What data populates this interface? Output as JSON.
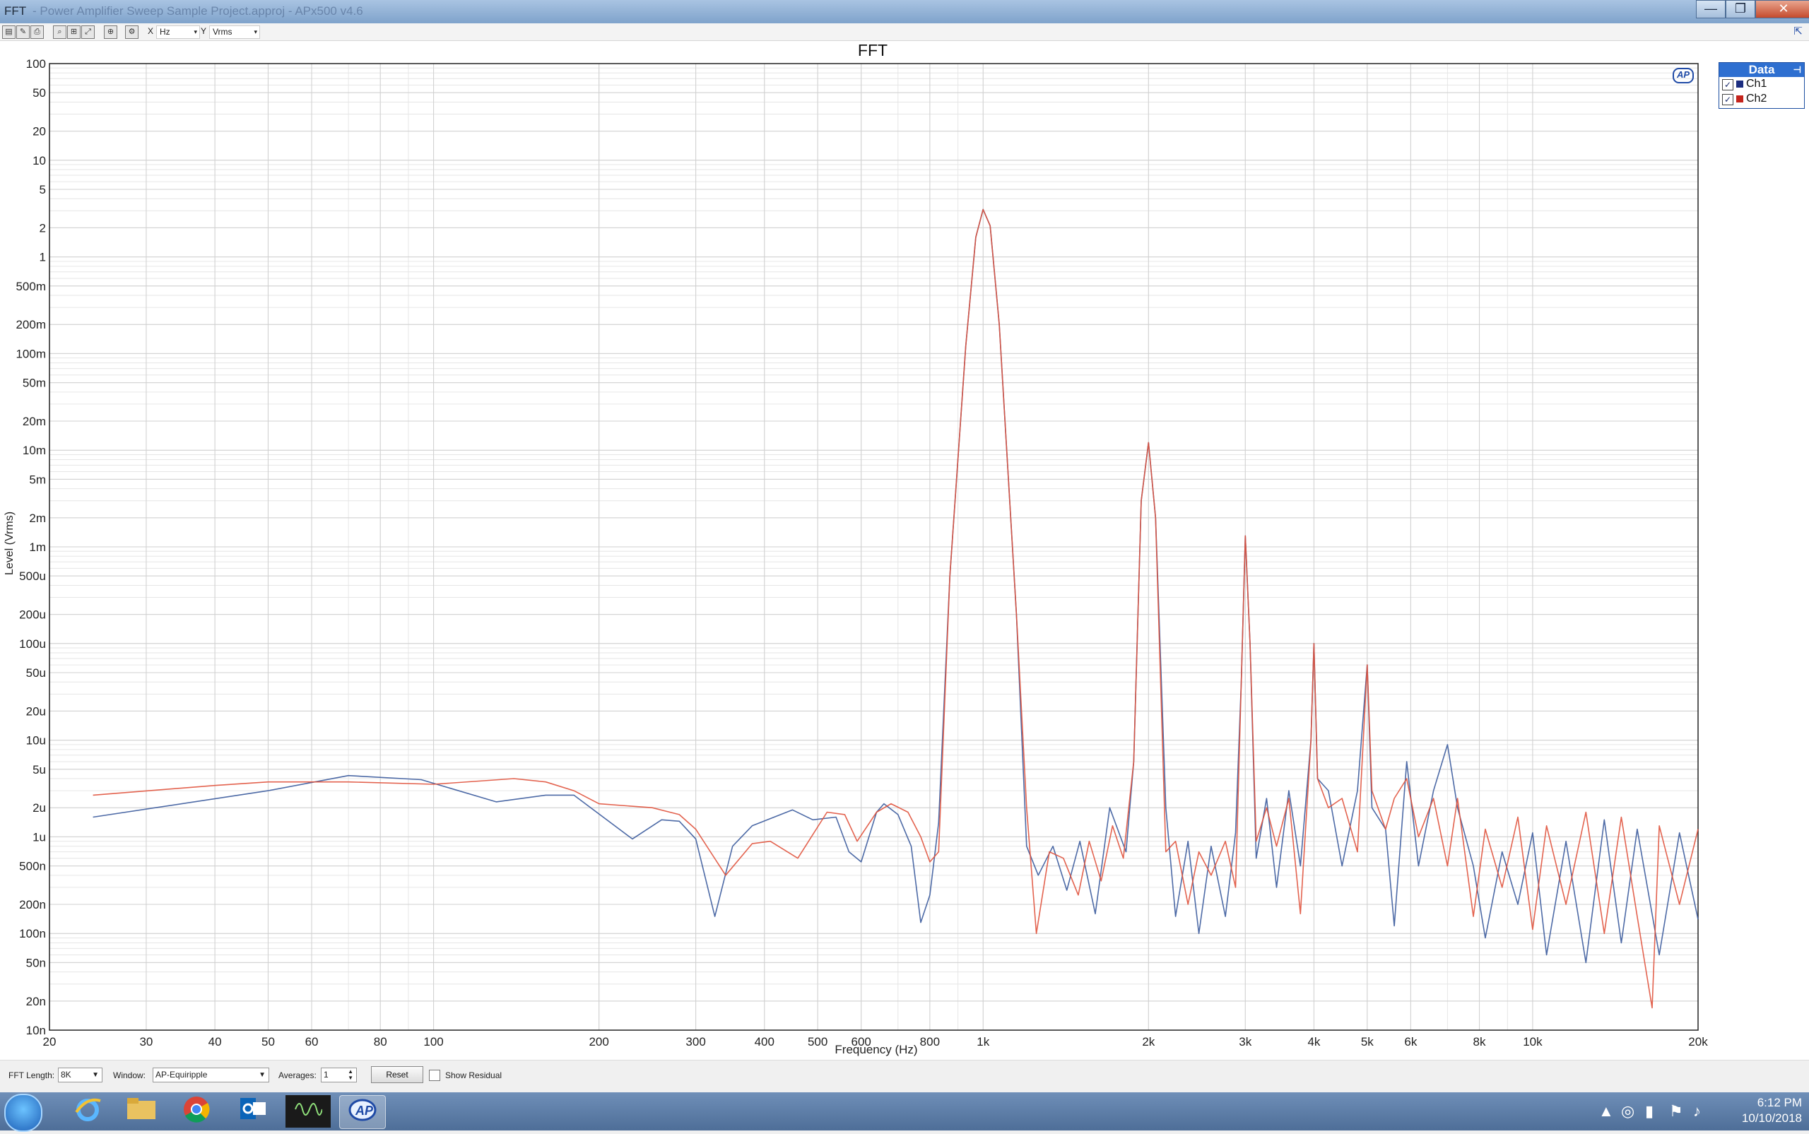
{
  "window": {
    "title_app": "FFT",
    "title_rest": "- Power Amplifier Sweep Sample Project.approj - APx500 v4.6",
    "minimize": "—",
    "maximize": "❐",
    "close": "✕"
  },
  "toolbar": {
    "x_label": "X",
    "x_unit": "Hz",
    "y_label": "Y",
    "y_unit": "Vrms",
    "arrow": "▾"
  },
  "legend": {
    "title": "Data",
    "pin": "⊣",
    "items": [
      {
        "name": "Ch1",
        "color": "#1c2e80",
        "checked": "✓"
      },
      {
        "name": "Ch2",
        "color": "#c4241c",
        "checked": "✓"
      }
    ]
  },
  "logo": "AP",
  "bottom": {
    "fft_length_label": "FFT Length:",
    "fft_length_value": "8K",
    "window_label": "Window:",
    "window_value": "AP-Equiripple",
    "averages_label": "Averages:",
    "averages_value": "1",
    "reset_label": "Reset",
    "show_residual_label": "Show Residual"
  },
  "taskbar": {
    "time": "6:12 PM",
    "date": "10/10/2018",
    "apps": [
      "windows-start",
      "internet-explorer",
      "file-explorer",
      "chrome",
      "outlook",
      "scope-app",
      "ap-app"
    ]
  },
  "chart_data": {
    "type": "line",
    "title": "FFT",
    "xlabel": "Frequency (Hz)",
    "ylabel": "Level (Vrms)",
    "x_scale": "log",
    "y_scale": "log",
    "xlim": [
      20,
      20000
    ],
    "ylim": [
      1e-08,
      100
    ],
    "grid": true,
    "legend_position": "right, outside plot",
    "x_ticks": [
      {
        "v": 20,
        "l": "20"
      },
      {
        "v": 30,
        "l": "30"
      },
      {
        "v": 40,
        "l": "40"
      },
      {
        "v": 50,
        "l": "50"
      },
      {
        "v": 60,
        "l": "60"
      },
      {
        "v": 80,
        "l": "80"
      },
      {
        "v": 100,
        "l": "100"
      },
      {
        "v": 200,
        "l": "200"
      },
      {
        "v": 300,
        "l": "300"
      },
      {
        "v": 400,
        "l": "400"
      },
      {
        "v": 500,
        "l": "500"
      },
      {
        "v": 600,
        "l": "600"
      },
      {
        "v": 800,
        "l": "800"
      },
      {
        "v": 1000,
        "l": "1k"
      },
      {
        "v": 2000,
        "l": "2k"
      },
      {
        "v": 3000,
        "l": "3k"
      },
      {
        "v": 4000,
        "l": "4k"
      },
      {
        "v": 5000,
        "l": "5k"
      },
      {
        "v": 6000,
        "l": "6k"
      },
      {
        "v": 8000,
        "l": "8k"
      },
      {
        "v": 10000,
        "l": "10k"
      },
      {
        "v": 20000,
        "l": "20k"
      }
    ],
    "y_ticks": [
      {
        "v": 100,
        "l": "100"
      },
      {
        "v": 50,
        "l": "50"
      },
      {
        "v": 20,
        "l": "20"
      },
      {
        "v": 10,
        "l": "10"
      },
      {
        "v": 5,
        "l": "5"
      },
      {
        "v": 2,
        "l": "2"
      },
      {
        "v": 1,
        "l": "1"
      },
      {
        "v": 0.5,
        "l": "500m"
      },
      {
        "v": 0.2,
        "l": "200m"
      },
      {
        "v": 0.1,
        "l": "100m"
      },
      {
        "v": 0.05,
        "l": "50m"
      },
      {
        "v": 0.02,
        "l": "20m"
      },
      {
        "v": 0.01,
        "l": "10m"
      },
      {
        "v": 0.005,
        "l": "5m"
      },
      {
        "v": 0.002,
        "l": "2m"
      },
      {
        "v": 0.001,
        "l": "1m"
      },
      {
        "v": 0.0005,
        "l": "500u"
      },
      {
        "v": 0.0002,
        "l": "200u"
      },
      {
        "v": 0.0001,
        "l": "100u"
      },
      {
        "v": 5e-05,
        "l": "50u"
      },
      {
        "v": 2e-05,
        "l": "20u"
      },
      {
        "v": 1e-05,
        "l": "10u"
      },
      {
        "v": 5e-06,
        "l": "5u"
      },
      {
        "v": 2e-06,
        "l": "2u"
      },
      {
        "v": 1e-06,
        "l": "1u"
      },
      {
        "v": 5e-07,
        "l": "500n"
      },
      {
        "v": 2e-07,
        "l": "200n"
      },
      {
        "v": 1e-07,
        "l": "100n"
      },
      {
        "v": 5e-08,
        "l": "50n"
      },
      {
        "v": 2e-08,
        "l": "20n"
      },
      {
        "v": 1e-08,
        "l": "10n"
      }
    ],
    "series": [
      {
        "name": "Ch1",
        "color": "#3a5a9c",
        "points": [
          [
            24,
            1.6e-06
          ],
          [
            50,
            3e-06
          ],
          [
            70,
            4.3e-06
          ],
          [
            95,
            3.9e-06
          ],
          [
            130,
            2.3e-06
          ],
          [
            160,
            2.7e-06
          ],
          [
            180,
            2.7e-06
          ],
          [
            230,
            9.5e-07
          ],
          [
            260,
            1.5e-06
          ],
          [
            280,
            1.45e-06
          ],
          [
            300,
            9.5e-07
          ],
          [
            325,
            1.5e-07
          ],
          [
            350,
            8e-07
          ],
          [
            380,
            1.3e-06
          ],
          [
            450,
            1.9e-06
          ],
          [
            490,
            1.5e-06
          ],
          [
            540,
            1.6e-06
          ],
          [
            570,
            7e-07
          ],
          [
            600,
            5.5e-07
          ],
          [
            640,
            1.8e-06
          ],
          [
            660,
            2.2e-06
          ],
          [
            700,
            1.7e-06
          ],
          [
            740,
            8e-07
          ],
          [
            770,
            1.3e-07
          ],
          [
            800,
            2.5e-07
          ],
          [
            830,
            1.4e-06
          ],
          [
            870,
            0.0005
          ],
          [
            930,
            0.12
          ],
          [
            970,
            1.6
          ],
          [
            1000,
            3.1
          ],
          [
            1030,
            2.1
          ],
          [
            1070,
            0.2
          ],
          [
            1150,
            0.0002
          ],
          [
            1200,
            8e-07
          ],
          [
            1260,
            4e-07
          ],
          [
            1340,
            8e-07
          ],
          [
            1420,
            2.8e-07
          ],
          [
            1500,
            9e-07
          ],
          [
            1600,
            1.6e-07
          ],
          [
            1700,
            2e-06
          ],
          [
            1820,
            7e-07
          ],
          [
            1880,
            6e-06
          ],
          [
            1940,
            0.003
          ],
          [
            2000,
            0.012
          ],
          [
            2060,
            0.002
          ],
          [
            2150,
            2e-06
          ],
          [
            2240,
            1.5e-07
          ],
          [
            2360,
            9e-07
          ],
          [
            2470,
            1e-07
          ],
          [
            2600,
            8e-07
          ],
          [
            2760,
            1.5e-07
          ],
          [
            2880,
            1.1e-06
          ],
          [
            2950,
            4e-05
          ],
          [
            3000,
            0.0013
          ],
          [
            3060,
            0.0001
          ],
          [
            3140,
            6e-07
          ],
          [
            3280,
            2.5e-06
          ],
          [
            3420,
            3e-07
          ],
          [
            3600,
            3e-06
          ],
          [
            3780,
            5e-07
          ],
          [
            3950,
            1e-05
          ],
          [
            4000,
            0.0001
          ],
          [
            4060,
            4e-06
          ],
          [
            4250,
            3e-06
          ],
          [
            4500,
            5e-07
          ],
          [
            4800,
            3e-06
          ],
          [
            5000,
            6e-05
          ],
          [
            5100,
            2e-06
          ],
          [
            5400,
            1.2e-06
          ],
          [
            5600,
            1.2e-07
          ],
          [
            5900,
            6e-06
          ],
          [
            6200,
            5e-07
          ],
          [
            6600,
            3e-06
          ],
          [
            7000,
            9e-06
          ],
          [
            7300,
            2e-06
          ],
          [
            7800,
            5e-07
          ],
          [
            8200,
            9e-08
          ],
          [
            8800,
            7e-07
          ],
          [
            9400,
            2e-07
          ],
          [
            10000,
            1.1e-06
          ],
          [
            10600,
            6e-08
          ],
          [
            11500,
            9e-07
          ],
          [
            12500,
            5e-08
          ],
          [
            13500,
            1.5e-06
          ],
          [
            14500,
            8e-08
          ],
          [
            15500,
            1.2e-06
          ],
          [
            17000,
            6e-08
          ],
          [
            18500,
            1.1e-06
          ],
          [
            20000,
            1.4e-07
          ]
        ]
      },
      {
        "name": "Ch2",
        "color": "#e0523c",
        "points": [
          [
            24,
            2.7e-06
          ],
          [
            40,
            3.4e-06
          ],
          [
            50,
            3.7e-06
          ],
          [
            70,
            3.7e-06
          ],
          [
            100,
            3.5e-06
          ],
          [
            140,
            4e-06
          ],
          [
            160,
            3.7e-06
          ],
          [
            180,
            3e-06
          ],
          [
            200,
            2.2e-06
          ],
          [
            250,
            2e-06
          ],
          [
            280,
            1.7e-06
          ],
          [
            300,
            1.2e-06
          ],
          [
            340,
            4e-07
          ],
          [
            380,
            8.5e-07
          ],
          [
            410,
            9e-07
          ],
          [
            460,
            6e-07
          ],
          [
            520,
            1.8e-06
          ],
          [
            560,
            1.7e-06
          ],
          [
            590,
            9e-07
          ],
          [
            640,
            1.8e-06
          ],
          [
            680,
            2.2e-06
          ],
          [
            730,
            1.8e-06
          ],
          [
            770,
            1e-06
          ],
          [
            800,
            5.5e-07
          ],
          [
            830,
            7e-07
          ],
          [
            870,
            0.0005
          ],
          [
            930,
            0.12
          ],
          [
            970,
            1.6
          ],
          [
            1000,
            3.1
          ],
          [
            1030,
            2.1
          ],
          [
            1070,
            0.2
          ],
          [
            1150,
            0.0002
          ],
          [
            1200,
            2e-06
          ],
          [
            1250,
            1e-07
          ],
          [
            1320,
            7e-07
          ],
          [
            1400,
            6e-07
          ],
          [
            1490,
            2.5e-07
          ],
          [
            1560,
            9e-07
          ],
          [
            1640,
            3.5e-07
          ],
          [
            1720,
            1.3e-06
          ],
          [
            1800,
            6e-07
          ],
          [
            1880,
            6e-06
          ],
          [
            1940,
            0.003
          ],
          [
            2000,
            0.012
          ],
          [
            2060,
            0.002
          ],
          [
            2150,
            7e-07
          ],
          [
            2240,
            9e-07
          ],
          [
            2360,
            2e-07
          ],
          [
            2470,
            7e-07
          ],
          [
            2600,
            4e-07
          ],
          [
            2760,
            9e-07
          ],
          [
            2880,
            3e-07
          ],
          [
            2950,
            4e-05
          ],
          [
            3000,
            0.0013
          ],
          [
            3060,
            0.0001
          ],
          [
            3140,
            9e-07
          ],
          [
            3280,
            2e-06
          ],
          [
            3420,
            8e-07
          ],
          [
            3600,
            2.5e-06
          ],
          [
            3780,
            1.6e-07
          ],
          [
            3950,
            1e-05
          ],
          [
            4000,
            0.0001
          ],
          [
            4060,
            4e-06
          ],
          [
            4250,
            2e-06
          ],
          [
            4500,
            2.5e-06
          ],
          [
            4800,
            7e-07
          ],
          [
            5000,
            6e-05
          ],
          [
            5100,
            3e-06
          ],
          [
            5400,
            1.2e-06
          ],
          [
            5600,
            2.5e-06
          ],
          [
            5900,
            4e-06
          ],
          [
            6200,
            1e-06
          ],
          [
            6600,
            2.5e-06
          ],
          [
            7000,
            5e-07
          ],
          [
            7300,
            2.5e-06
          ],
          [
            7800,
            1.5e-07
          ],
          [
            8200,
            1.2e-06
          ],
          [
            8800,
            3e-07
          ],
          [
            9400,
            1.6e-06
          ],
          [
            10000,
            1.1e-07
          ],
          [
            10600,
            1.3e-06
          ],
          [
            11500,
            2e-07
          ],
          [
            12500,
            1.8e-06
          ],
          [
            13500,
            1e-07
          ],
          [
            14500,
            1.6e-06
          ],
          [
            15500,
            1.5e-07
          ],
          [
            16500,
            1.7e-08
          ],
          [
            17000,
            1.3e-06
          ],
          [
            18500,
            2e-07
          ],
          [
            20000,
            1.2e-06
          ]
        ]
      }
    ]
  }
}
